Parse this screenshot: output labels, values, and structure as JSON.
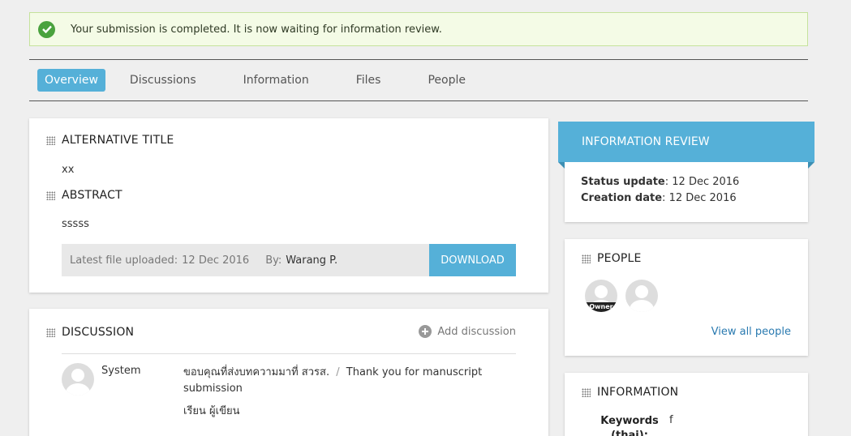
{
  "alert": {
    "message": "Your submission is completed. It is now waiting for information review."
  },
  "tabs": [
    {
      "label": "Overview"
    },
    {
      "label": "Discussions"
    },
    {
      "label": "Information"
    },
    {
      "label": "Files"
    },
    {
      "label": "People"
    }
  ],
  "overview": {
    "alt_title_heading": "ALTERNATIVE TITLE",
    "alt_title_value": "xx",
    "abstract_heading": "ABSTRACT",
    "abstract_value": "sssss",
    "file_label": "Latest file uploaded:",
    "file_date": "12 Dec 2016",
    "by_label": "By:",
    "by_name": "Warang P.",
    "download_label": "DOWNLOAD"
  },
  "discussion": {
    "heading": "DISCUSSION",
    "add_label": "Add discussion",
    "items": [
      {
        "author": "System",
        "message_thai": "ขอบคุณที่ส่งบทความมาที่ สวรส.",
        "separator": "/",
        "message_en": "Thank you for manuscript submission",
        "greeting": "เรียน ผู้เขียน"
      }
    ]
  },
  "review": {
    "title": "INFORMATION REVIEW",
    "status_label": "Status update",
    "status_value": "12 Dec 2016",
    "creation_label": "Creation date",
    "creation_value": "12 Dec 2016"
  },
  "people": {
    "heading": "PEOPLE",
    "owner_tag": "Owner",
    "view_all": "View all people"
  },
  "information": {
    "heading": "INFORMATION",
    "keywords_label": "Keywords (thai):",
    "keywords_value": "f"
  },
  "colors": {
    "accent": "#55b0d8",
    "success": "#4aa23e",
    "alert_bg": "#f4fbe6"
  }
}
